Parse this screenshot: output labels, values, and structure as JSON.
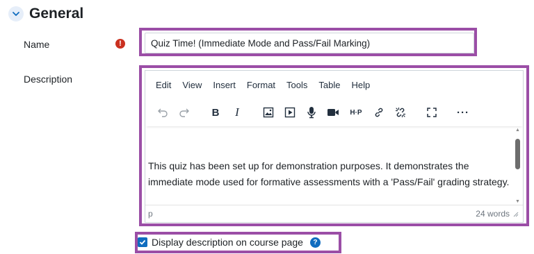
{
  "section": {
    "title": "General",
    "expand_icon": "chevron-down-icon"
  },
  "name_field": {
    "label": "Name",
    "required_icon": "exclamation-icon",
    "required_glyph": "!",
    "value": "Quiz Time! (Immediate Mode and Pass/Fail Marking)"
  },
  "description": {
    "label": "Description",
    "menubar": [
      "Edit",
      "View",
      "Insert",
      "Format",
      "Tools",
      "Table",
      "Help"
    ],
    "toolbar_icons": [
      "undo-icon",
      "redo-icon",
      "bold-icon",
      "italic-icon",
      "image-icon",
      "media-icon",
      "microphone-icon",
      "video-camera-icon",
      "h5p-icon",
      "link-icon",
      "unlink-icon",
      "fullscreen-icon",
      "more-icon"
    ],
    "toolbar_labels": {
      "bold": "B",
      "italic": "I",
      "h5p": "H·P",
      "more": "···"
    },
    "content_text": "This quiz has been set up for demonstration purposes. It demonstrates the immediate mode used for formative assessments with a 'Pass/Fail' grading strategy.",
    "status_path": "p",
    "word_count": "24 words"
  },
  "display_option": {
    "checked": true,
    "label": "Display description on course page",
    "help_glyph": "?"
  },
  "colors": {
    "highlight": "#9b4ea6",
    "required": "#ca3120",
    "primary": "#0f6cbf"
  }
}
